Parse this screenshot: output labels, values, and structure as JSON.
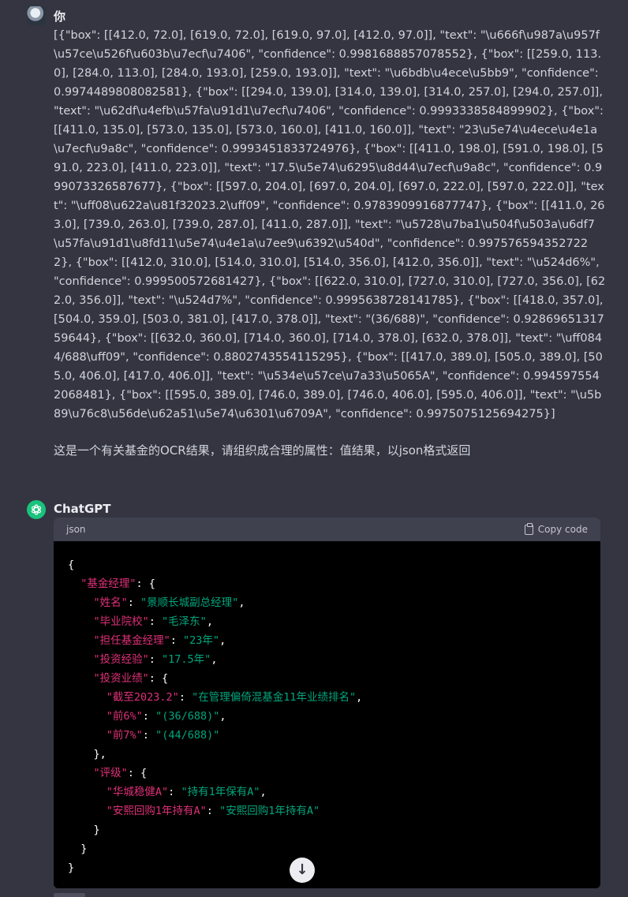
{
  "user": {
    "name": "你",
    "ocr_text": "[{\"box\": [[412.0, 72.0], [619.0, 72.0], [619.0, 97.0], [412.0, 97.0]], \"text\": \"\\u666f\\u987a\\u957f\\u57ce\\u526f\\u603b\\u7ecf\\u7406\", \"confidence\": 0.9981688857078552}, {\"box\": [[259.0, 113.0], [284.0, 113.0], [284.0, 193.0], [259.0, 193.0]], \"text\": \"\\u6bdb\\u4ece\\u5bb9\", \"confidence\": 0.9974489808082581}, {\"box\": [[294.0, 139.0], [314.0, 139.0], [314.0, 257.0], [294.0, 257.0]], \"text\": \"\\u62df\\u4efb\\u57fa\\u91d1\\u7ecf\\u7406\", \"confidence\": 0.9993338584899902}, {\"box\": [[411.0, 135.0], [573.0, 135.0], [573.0, 160.0], [411.0, 160.0]], \"text\": \"23\\u5e74\\u4ece\\u4e1a\\u7ecf\\u9a8c\", \"confidence\": 0.9993451833724976}, {\"box\": [[411.0, 198.0], [591.0, 198.0], [591.0, 223.0], [411.0, 223.0]], \"text\": \"17.5\\u5e74\\u6295\\u8d44\\u7ecf\\u9a8c\", \"confidence\": 0.999073326587677}, {\"box\": [[597.0, 204.0], [697.0, 204.0], [697.0, 222.0], [597.0, 222.0]], \"text\": \"\\uff08\\u622a\\u81f32023.2\\uff09\", \"confidence\": 0.9783909916877747}, {\"box\": [[411.0, 263.0], [739.0, 263.0], [739.0, 287.0], [411.0, 287.0]], \"text\": \"\\u5728\\u7ba1\\u504f\\u503a\\u6df7\\u57fa\\u91d1\\u8fd11\\u5e74\\u4e1a\\u7ee9\\u6392\\u540d\", \"confidence\": 0.9975765943527222}, {\"box\": [[412.0, 310.0], [514.0, 310.0], [514.0, 356.0], [412.0, 356.0]], \"text\": \"\\u524d6%\", \"confidence\": 0.999500572681427}, {\"box\": [[622.0, 310.0], [727.0, 310.0], [727.0, 356.0], [622.0, 356.0]], \"text\": \"\\u524d7%\", \"confidence\": 0.9995638728141785}, {\"box\": [[418.0, 357.0], [504.0, 359.0], [503.0, 381.0], [417.0, 378.0]], \"text\": \"(36/688)\", \"confidence\": 0.9286965131759644}, {\"box\": [[632.0, 360.0], [714.0, 360.0], [714.0, 378.0], [632.0, 378.0]], \"text\": \"\\uff0844/688\\uff09\", \"confidence\": 0.8802743554115295}, {\"box\": [[417.0, 389.0], [505.0, 389.0], [505.0, 406.0], [417.0, 406.0]], \"text\": \"\\u534e\\u57ce\\u7a33\\u5065A\", \"confidence\": 0.9945975542068481}, {\"box\": [[595.0, 389.0], [746.0, 389.0], [746.0, 406.0], [595.0, 406.0]], \"text\": \"\\u5b89\\u76c8\\u56de\\u62a51\\u5e74\\u6301\\u6709A\", \"confidence\": 0.9975075125694275}]",
    "question": "这是一个有关基金的OCR结果，请组织成合理的属性：值结果，以json格式返回"
  },
  "assistant": {
    "name": "ChatGPT",
    "code_lang": "json",
    "copy_label": "Copy code",
    "lines": [
      {
        "indent": "",
        "parts": [
          {
            "t": "{",
            "c": "p"
          }
        ]
      },
      {
        "indent": "  ",
        "parts": [
          {
            "t": "\"基金经理\"",
            "c": "k"
          },
          {
            "t": ": {",
            "c": "p"
          }
        ]
      },
      {
        "indent": "    ",
        "parts": [
          {
            "t": "\"姓名\"",
            "c": "k"
          },
          {
            "t": ": ",
            "c": "p"
          },
          {
            "t": "\"景顺长城副总经理\"",
            "c": "s"
          },
          {
            "t": ",",
            "c": "p"
          }
        ]
      },
      {
        "indent": "    ",
        "parts": [
          {
            "t": "\"毕业院校\"",
            "c": "k"
          },
          {
            "t": ": ",
            "c": "p"
          },
          {
            "t": "\"毛泽东\"",
            "c": "s"
          },
          {
            "t": ",",
            "c": "p"
          }
        ]
      },
      {
        "indent": "    ",
        "parts": [
          {
            "t": "\"担任基金经理\"",
            "c": "k"
          },
          {
            "t": ": ",
            "c": "p"
          },
          {
            "t": "\"23年\"",
            "c": "s"
          },
          {
            "t": ",",
            "c": "p"
          }
        ]
      },
      {
        "indent": "    ",
        "parts": [
          {
            "t": "\"投资经验\"",
            "c": "k"
          },
          {
            "t": ": ",
            "c": "p"
          },
          {
            "t": "\"17.5年\"",
            "c": "s"
          },
          {
            "t": ",",
            "c": "p"
          }
        ]
      },
      {
        "indent": "    ",
        "parts": [
          {
            "t": "\"投资业绩\"",
            "c": "k"
          },
          {
            "t": ": {",
            "c": "p"
          }
        ]
      },
      {
        "indent": "      ",
        "parts": [
          {
            "t": "\"截至2023.2\"",
            "c": "k"
          },
          {
            "t": ": ",
            "c": "p"
          },
          {
            "t": "\"在管理偏倚混基金11年业绩排名\"",
            "c": "s"
          },
          {
            "t": ",",
            "c": "p"
          }
        ]
      },
      {
        "indent": "      ",
        "parts": [
          {
            "t": "\"前6%\"",
            "c": "k"
          },
          {
            "t": ": ",
            "c": "p"
          },
          {
            "t": "\"(36/688)\"",
            "c": "s"
          },
          {
            "t": ",",
            "c": "p"
          }
        ]
      },
      {
        "indent": "      ",
        "parts": [
          {
            "t": "\"前7%\"",
            "c": "k"
          },
          {
            "t": ": ",
            "c": "p"
          },
          {
            "t": "\"(44/688)\"",
            "c": "s"
          }
        ]
      },
      {
        "indent": "    ",
        "parts": [
          {
            "t": "},",
            "c": "p"
          }
        ]
      },
      {
        "indent": "    ",
        "parts": [
          {
            "t": "\"评级\"",
            "c": "k"
          },
          {
            "t": ": {",
            "c": "p"
          }
        ]
      },
      {
        "indent": "      ",
        "parts": [
          {
            "t": "\"华城稳健A\"",
            "c": "k"
          },
          {
            "t": ": ",
            "c": "p"
          },
          {
            "t": "\"持有1年保有A\"",
            "c": "s"
          },
          {
            "t": ",",
            "c": "p"
          }
        ]
      },
      {
        "indent": "      ",
        "parts": [
          {
            "t": "\"安熙回购1年持有A\"",
            "c": "k"
          },
          {
            "t": ": ",
            "c": "p"
          },
          {
            "t": "\"安熙回购1年持有A\"",
            "c": "s"
          }
        ]
      },
      {
        "indent": "    ",
        "parts": [
          {
            "t": "}",
            "c": "p"
          }
        ]
      },
      {
        "indent": "  ",
        "parts": [
          {
            "t": "}",
            "c": "p"
          }
        ]
      },
      {
        "indent": "",
        "parts": [
          {
            "t": "}",
            "c": "p"
          }
        ]
      }
    ]
  },
  "icons": {
    "copy": "copy-icon",
    "scroll": "arrow-down-icon",
    "bot_avatar": "openai-logo-icon",
    "user_avatar": "user-avatar-icon"
  },
  "colors": {
    "background": "#343541",
    "code_background": "#000000",
    "code_header": "#40414f",
    "key": "#df3079",
    "string": "#00a67d",
    "bot_avatar": "#19c37d"
  }
}
